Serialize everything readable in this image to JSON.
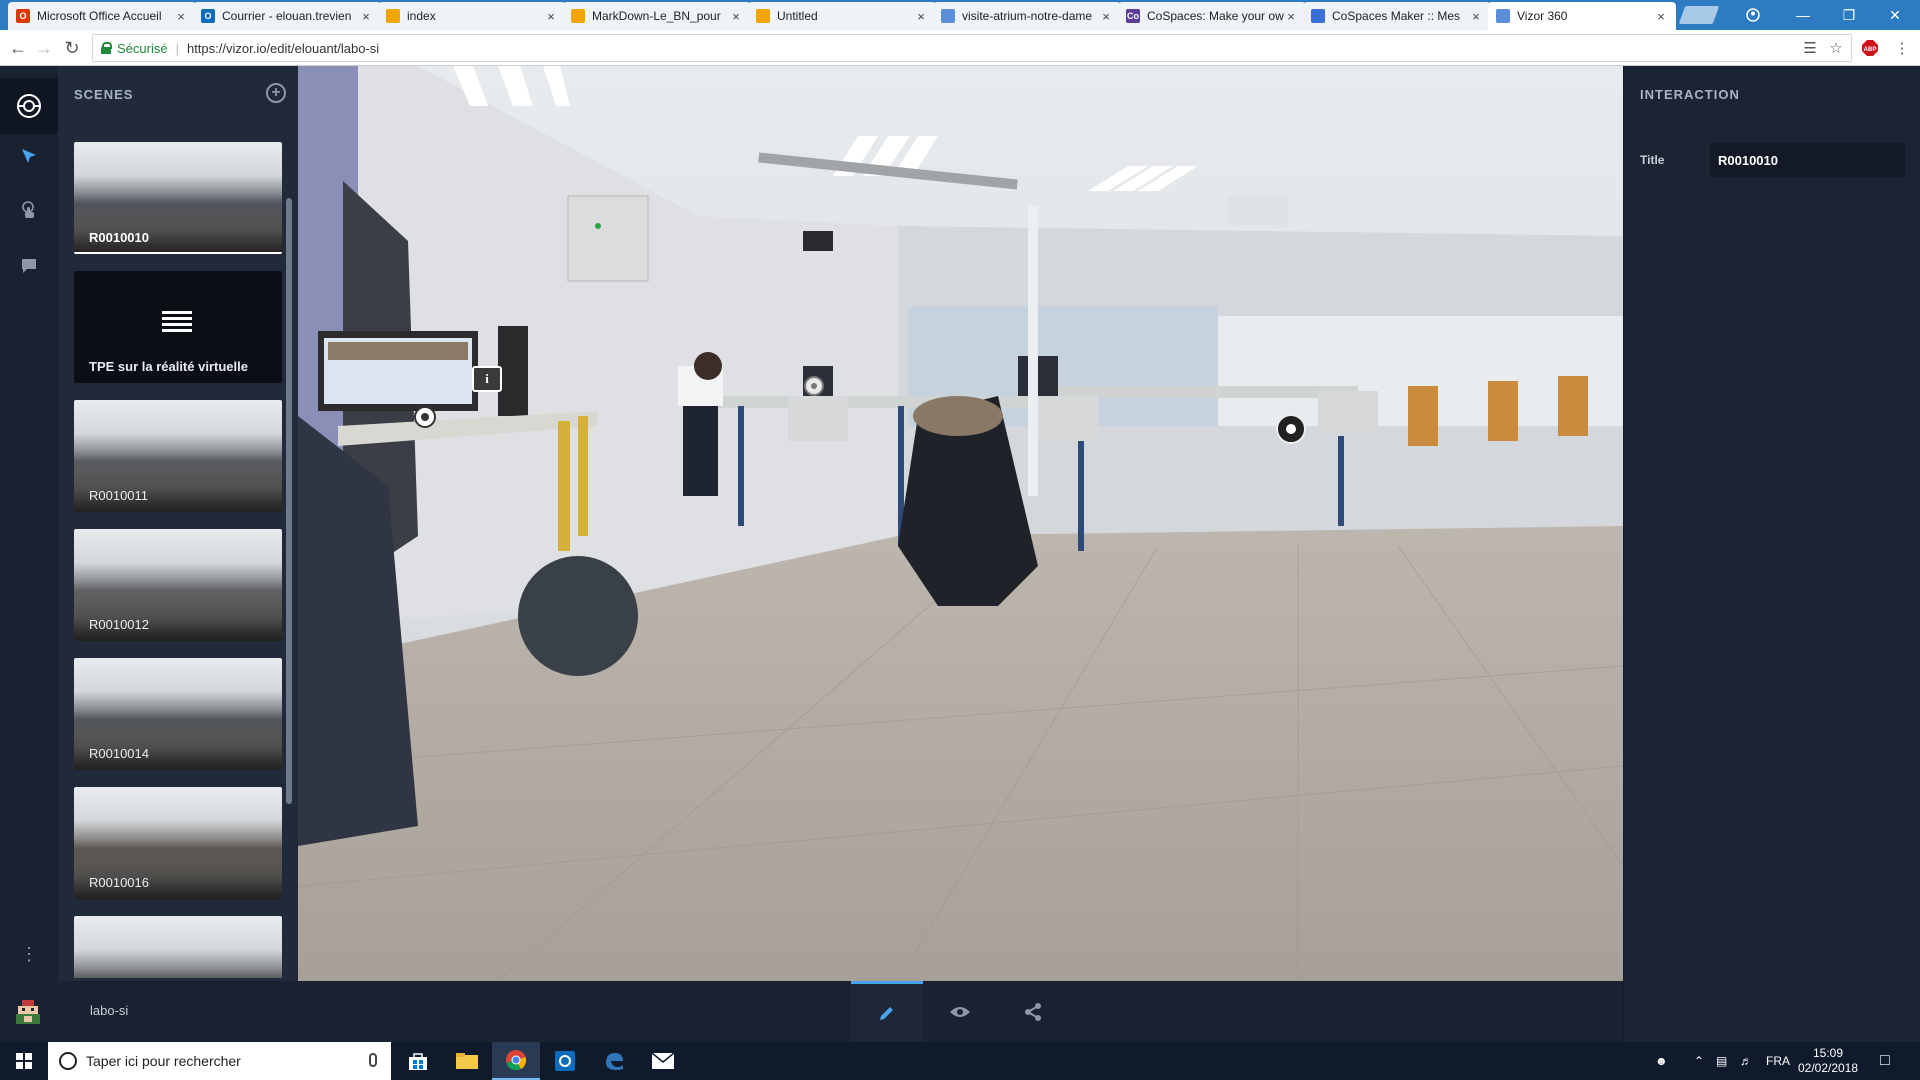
{
  "browser": {
    "tabs": [
      {
        "title": "Microsoft Office Accueil",
        "favicon_color": "#d83b01",
        "favicon_glyph": "O"
      },
      {
        "title": "Courrier - elouan.trevien",
        "favicon_color": "#0f6cbd",
        "favicon_glyph": "O"
      },
      {
        "title": "index",
        "favicon_color": "#f0a500",
        "favicon_glyph": ""
      },
      {
        "title": "MarkDown-Le_BN_pour",
        "favicon_color": "#f0a500",
        "favicon_glyph": ""
      },
      {
        "title": "Untitled",
        "favicon_color": "#f0a500",
        "favicon_glyph": ""
      },
      {
        "title": "visite-atrium-notre-dame",
        "favicon_color": "#5a8ed6",
        "favicon_glyph": ""
      },
      {
        "title": "CoSpaces: Make your own",
        "favicon_color": "#5c3d99",
        "favicon_glyph": "Co"
      },
      {
        "title": "CoSpaces Maker :: Mes",
        "favicon_color": "#3a6fd8",
        "favicon_glyph": ""
      },
      {
        "title": "Vizor 360",
        "favicon_color": "#5a8ed6",
        "favicon_glyph": ""
      }
    ],
    "active_tab_index": 8,
    "secure_label": "Sécurisé",
    "url": "https://vizor.io/edit/elouant/labo-si"
  },
  "app": {
    "scenes_header": "SCENES",
    "scenes": [
      {
        "label": "R0010010",
        "kind": "photo",
        "selected": true
      },
      {
        "label": "TPE sur la réalité virtuelle",
        "kind": "text",
        "selected": false
      },
      {
        "label": "R0010011",
        "kind": "photo",
        "selected": false
      },
      {
        "label": "R0010012",
        "kind": "photo",
        "selected": false
      },
      {
        "label": "R0010014",
        "kind": "photo",
        "selected": false
      },
      {
        "label": "R0010016",
        "kind": "photo",
        "selected": false
      },
      {
        "label": "",
        "kind": "photo",
        "selected": false
      }
    ],
    "inspector": {
      "header": "INTERACTION",
      "title_label": "Title",
      "title_value": "R0010010"
    },
    "project_name": "labo-si",
    "accent_color": "#4aa3ef"
  },
  "taskbar": {
    "search_placeholder": "Taper ici pour rechercher",
    "language": "FRA",
    "time": "15:09",
    "date": "02/02/2018"
  }
}
